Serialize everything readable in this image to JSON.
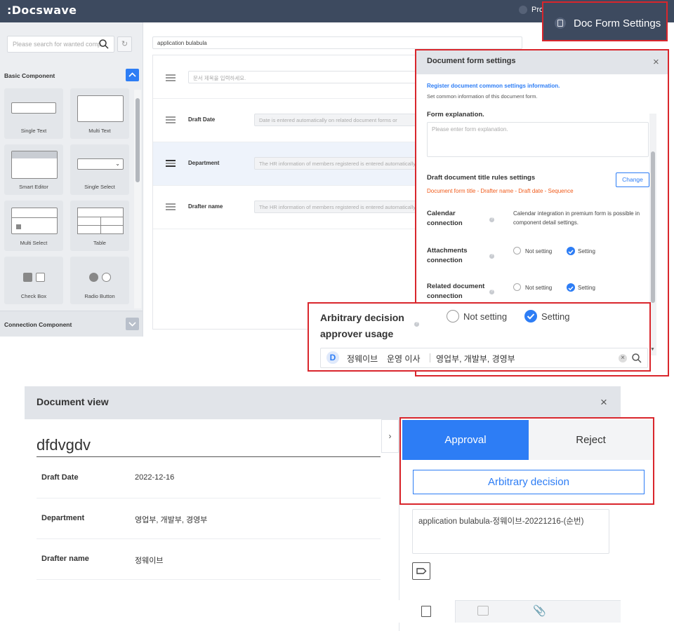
{
  "app": {
    "logo": ":Docswave",
    "profile_label": "Pro"
  },
  "sidebar": {
    "search_placeholder": "Please search for wanted comp",
    "basic_header": "Basic Component",
    "connection_header": "Connection Component",
    "tiles": [
      "Single Text",
      "Multi Text",
      "Smart Editor",
      "Single Select",
      "Multi Select",
      "Table",
      "Check Box",
      "Radio Button"
    ]
  },
  "form": {
    "title_value": "application bulabula",
    "doc_title_placeholder": "문서 제목을 입력하세요.",
    "rows": [
      {
        "label": "Draft Date",
        "placeholder": "Date is entered automatically on related document forms or"
      },
      {
        "label": "Department",
        "placeholder": "The HR information of members registered is entered automatically"
      },
      {
        "label": "Drafter name",
        "placeholder": "The HR information of members registered is entered automatically"
      }
    ]
  },
  "doc_form_settings_button": "Doc Form Settings",
  "settings": {
    "title": "Document form settings",
    "register_title": "Register document common settings information.",
    "register_desc": "Set common information of this document form.",
    "form_expl_label": "Form explanation.",
    "form_expl_placeholder": "Please enter form explanation.",
    "title_rules_label": "Draft document title rules settings",
    "change_button": "Change",
    "title_rule_value": "Document form title - Drafter name - Draft date - Sequence",
    "calendar_label": "Calendar connection",
    "calendar_desc": "Calendar integration in premium form is possible in component detail settings.",
    "attachments_label": "Attachments connection",
    "related_label": "Related document connection",
    "not_setting": "Not setting",
    "setting": "Setting"
  },
  "arbitrary": {
    "label": "Arbitrary decision approver usage",
    "not_setting": "Not setting",
    "setting": "Setting",
    "approver_name": "정웨이브",
    "approver_role": "운영 이사",
    "approver_depts": "영업부, 개발부, 경영부"
  },
  "docview": {
    "header": "Document view",
    "doc_title": "dfdvgdv",
    "rows": [
      {
        "label": "Draft Date",
        "value": "2022-12-16"
      },
      {
        "label": "Department",
        "value": "영업부, 개발부, 경영부"
      },
      {
        "label": "Drafter name",
        "value": "정웨이브"
      }
    ],
    "approval_tab": "Approval",
    "reject_tab": "Reject",
    "arbitrary_button": "Arbitrary decision",
    "comment_text": "application bulabula-정웨이브-20221216-(순번)"
  },
  "colors": {
    "accent": "#2d7df5",
    "topbar": "#3d4a5f",
    "highlight": "#d9262c",
    "rule_orange": "#f05a1a"
  }
}
